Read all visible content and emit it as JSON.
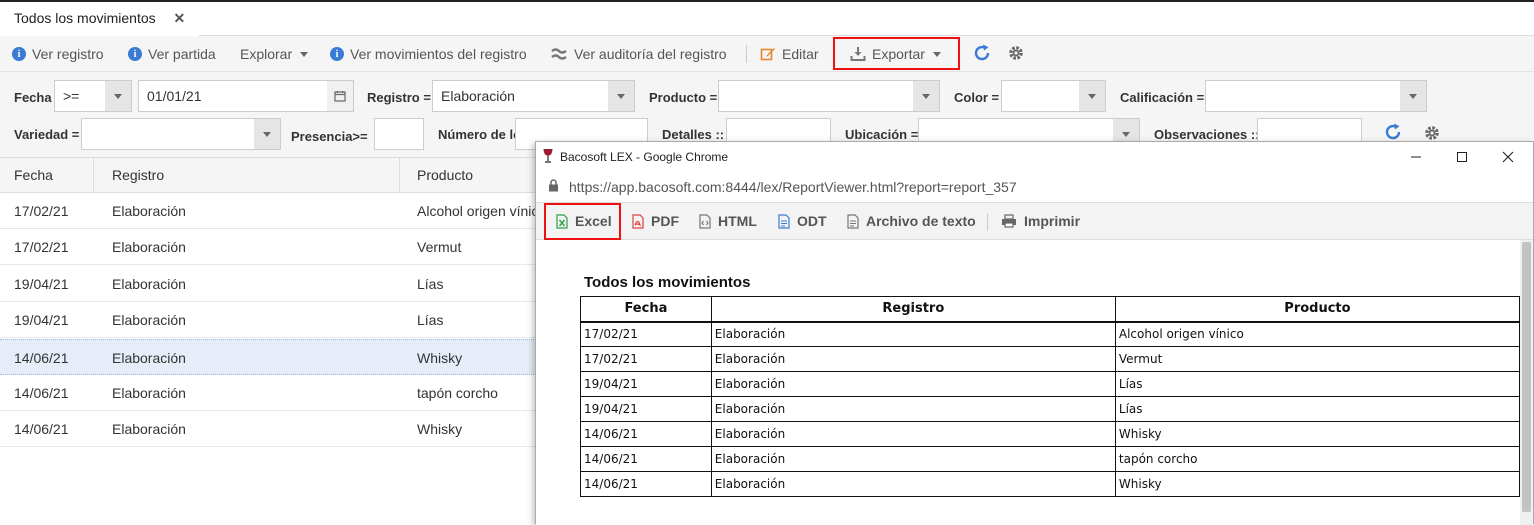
{
  "tab": {
    "title": "Todos los movimientos",
    "close": "✕"
  },
  "toolbar": {
    "ver_registro": "Ver registro",
    "ver_partida": "Ver partida",
    "explorar": "Explorar",
    "ver_movimientos": "Ver movimientos del registro",
    "ver_auditoria": "Ver auditoría del registro",
    "editar": "Editar",
    "exportar": "Exportar"
  },
  "filters": {
    "fecha_label": "Fecha",
    "fecha_op": ">=",
    "fecha_value": "01/01/21",
    "registro_label": "Registro =",
    "registro_value": "Elaboración",
    "producto_label": "Producto =",
    "producto_value": "",
    "color_label": "Color =",
    "color_value": "",
    "calificacion_label": "Calificación =",
    "calificacion_value": "",
    "variedad_label": "Variedad =",
    "variedad_value": "",
    "presencia_label": "Presencia>=",
    "presencia_value": "",
    "lote_label": "Número de lote ::",
    "detalles_label": "Detalles ::",
    "ubicacion_label": "Ubicación =",
    "observaciones_label": "Observaciones ::"
  },
  "grid": {
    "columns": [
      "Fecha",
      "Registro",
      "Producto"
    ],
    "rows": [
      [
        "17/02/21",
        "Elaboración",
        "Alcohol origen vínico"
      ],
      [
        "17/02/21",
        "Elaboración",
        "Vermut"
      ],
      [
        "19/04/21",
        "Elaboración",
        "Lías"
      ],
      [
        "19/04/21",
        "Elaboración",
        "Lías"
      ],
      [
        "14/06/21",
        "Elaboración",
        "Whisky"
      ],
      [
        "14/06/21",
        "Elaboración",
        "tapón corcho"
      ],
      [
        "14/06/21",
        "Elaboración",
        "Whisky"
      ]
    ],
    "selected_row": 4
  },
  "popup": {
    "window_title": "Bacosoft LEX - Google Chrome",
    "url": "https://app.bacosoft.com:8444/lex/ReportViewer.html?report=report_357",
    "toolbar": {
      "excel": "Excel",
      "pdf": "PDF",
      "html": "HTML",
      "odt": "ODT",
      "texto": "Archivo de texto",
      "imprimir": "Imprimir"
    },
    "report": {
      "title": "Todos los movimientos",
      "columns": [
        "Fecha",
        "Registro",
        "Producto"
      ],
      "rows": [
        [
          "17/02/21",
          "Elaboración",
          "Alcohol origen vínico"
        ],
        [
          "17/02/21",
          "Elaboración",
          "Vermut"
        ],
        [
          "19/04/21",
          "Elaboración",
          "Lías"
        ],
        [
          "19/04/21",
          "Elaboración",
          "Lías"
        ],
        [
          "14/06/21",
          "Elaboración",
          "Whisky"
        ],
        [
          "14/06/21",
          "Elaboración",
          "tapón corcho"
        ],
        [
          "14/06/21",
          "Elaboración",
          "Whisky"
        ]
      ]
    }
  },
  "colors": {
    "info_blue": "#3a7bd5",
    "highlight_red": "#ee1111",
    "edit_orange": "#e8862a",
    "excel_green": "#2e9e4a",
    "pdf_red": "#d9453d",
    "odt_blue": "#3a7bd5",
    "selected_row": "#e6edf8"
  }
}
